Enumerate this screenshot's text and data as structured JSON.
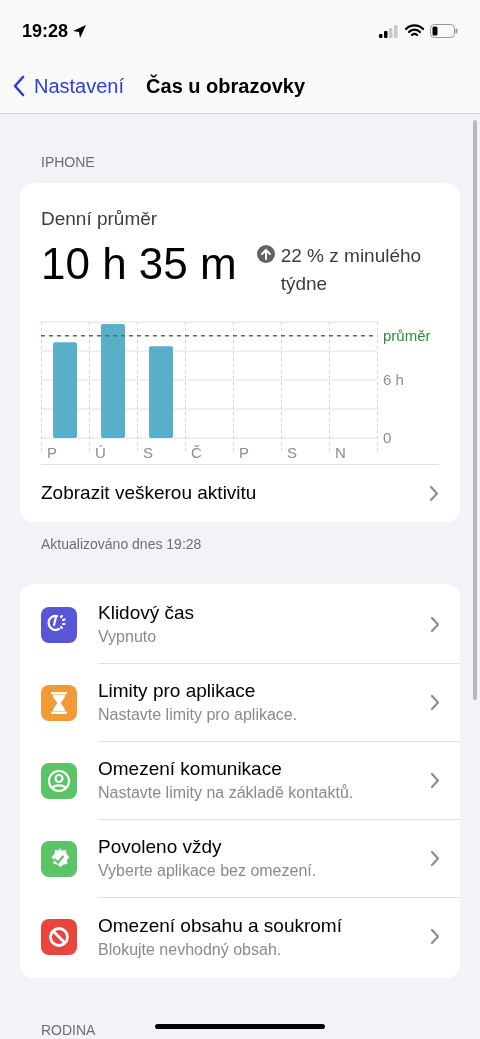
{
  "status_bar": {
    "time": "19:28"
  },
  "nav": {
    "back": "Nastavení",
    "title": "Čas u obrazovky"
  },
  "section_header": "IPHONE",
  "summary": {
    "label": "Denní průměr",
    "value": "10 h 35 m",
    "change": "22 % z minulého týdne",
    "chart_data": {
      "type": "bar",
      "categories": [
        "P",
        "Ú",
        "S",
        "Č",
        "P",
        "S",
        "N"
      ],
      "series": [
        {
          "color": "#5aafc8",
          "values": [
            9.9,
            11.8,
            9.5,
            null,
            null,
            null,
            null
          ]
        }
      ],
      "ylim": [
        0,
        12
      ],
      "yticks": [
        0,
        {
          "value": 6,
          "label": "6 h"
        }
      ],
      "ref_lines": [
        {
          "axis": "y",
          "value": 10.58,
          "label": "průměr",
          "color": "#2e8b3a"
        }
      ]
    },
    "link": "Zobrazit veškerou aktivitu"
  },
  "updated": "Aktualizováno dnes 19:28",
  "settings": [
    {
      "kind": "downtime",
      "title": "Klidový čas",
      "subtitle": "Vypnuto",
      "color": "#5856d6"
    },
    {
      "kind": "app_limits",
      "title": "Limity pro aplikace",
      "subtitle": "Nastavte limity pro aplikace.",
      "color": "#f29a38"
    },
    {
      "kind": "communication",
      "title": "Omezení komunikace",
      "subtitle": "Nastavte limity na základě kontaktů.",
      "color": "#5ac467"
    },
    {
      "kind": "always_allowed",
      "title": "Povoleno vždy",
      "subtitle": "Vyberte aplikace bez omezení.",
      "color": "#5ac467"
    },
    {
      "kind": "content",
      "title": "Omezení obsahu a soukromí",
      "subtitle": "Blokujte nevhodný obsah.",
      "color": "#e8453c"
    }
  ],
  "footer_header": "RODINA"
}
